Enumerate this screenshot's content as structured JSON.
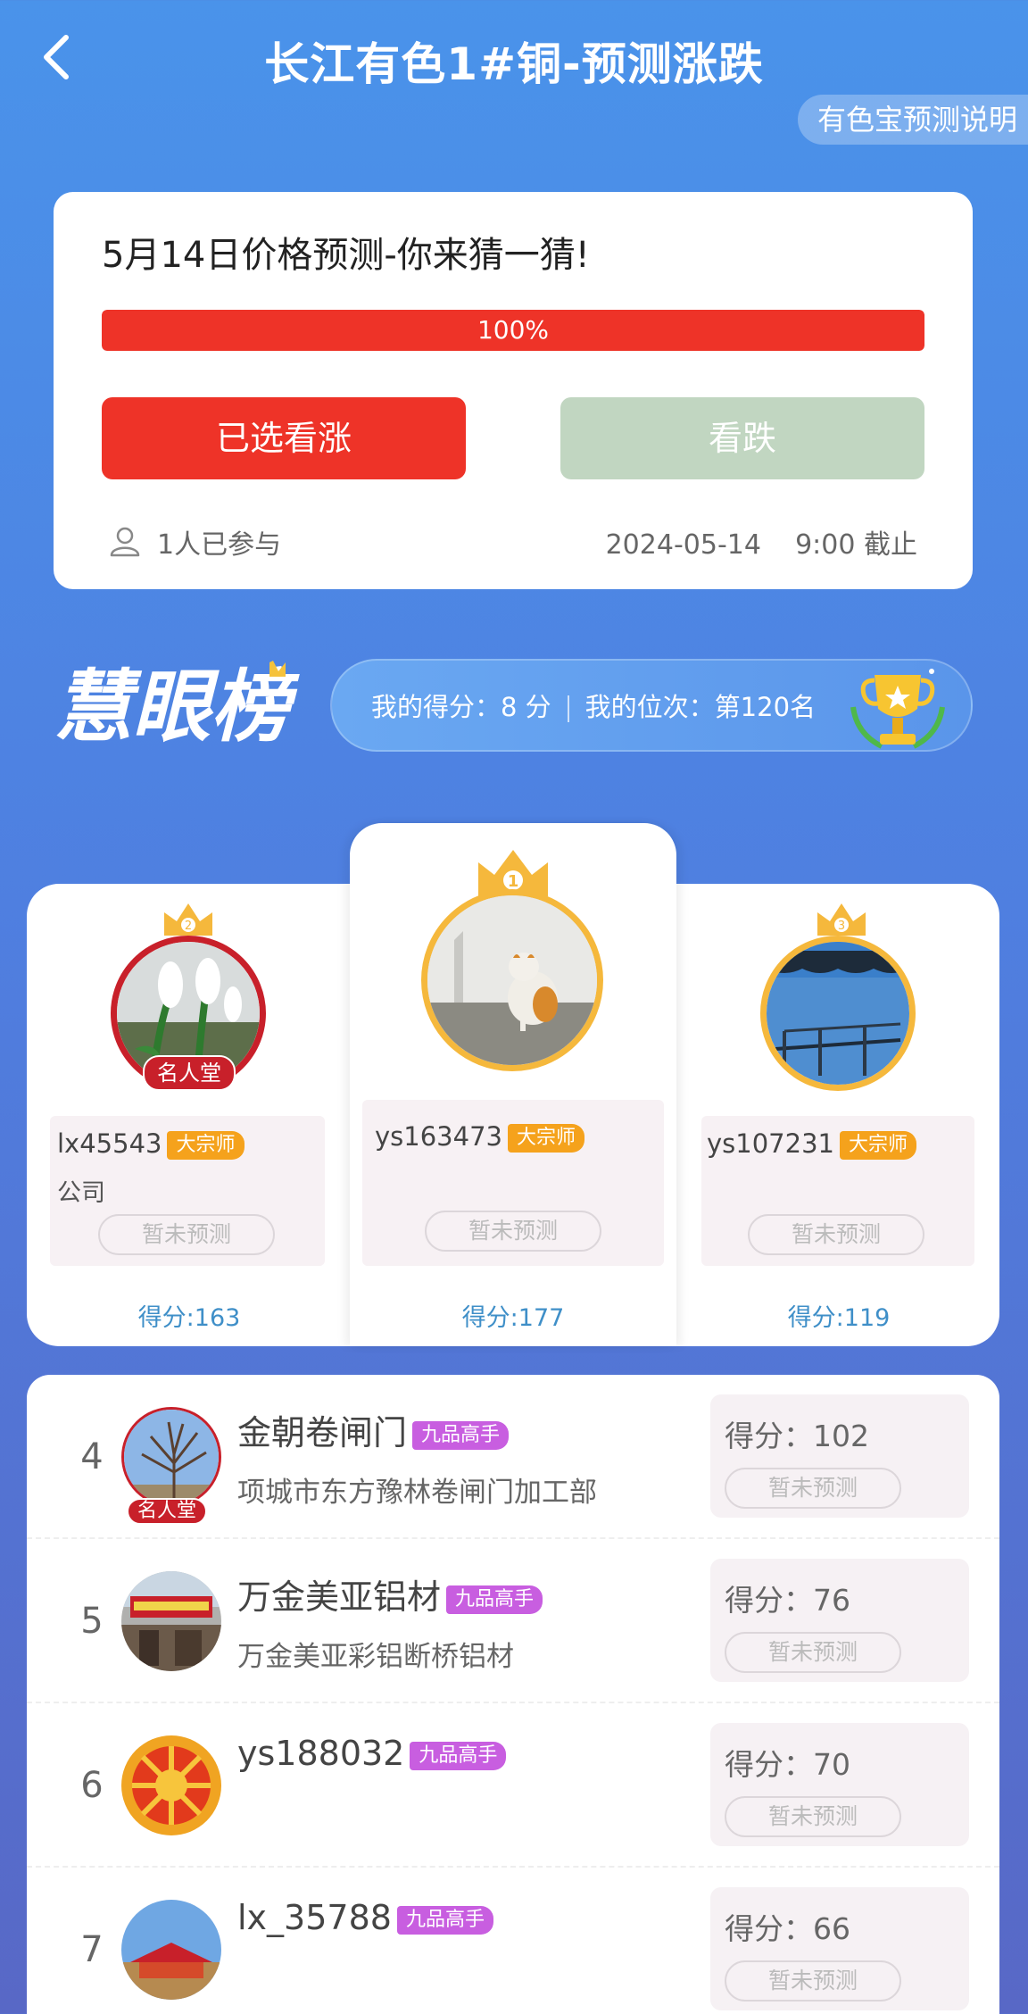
{
  "header": {
    "title": "长江有色1#铜-预测涨跌",
    "explain_label": "有色宝预测说明"
  },
  "predict": {
    "title": "5月14日价格预测-你来猜一猜!",
    "progress_label": "100%",
    "progress_value": 100,
    "up_button": "已选看涨",
    "down_button": "看跌",
    "participants": "1人已参与",
    "deadline": "2024-05-14    9:00 截止",
    "colors": {
      "up": "#ee3328",
      "down": "#c1d6c1"
    }
  },
  "ranking": {
    "my_score": "我的得分：8 分",
    "my_rank": "我的位次：第120名"
  },
  "podium": [
    {
      "rank": "2",
      "name": "lx45543",
      "badge": "大宗师",
      "sub": "公司",
      "fame": "名人堂",
      "status": "暂未预测",
      "score": "得分:163"
    },
    {
      "rank": "1",
      "name": "ys163473",
      "badge": "大宗师",
      "sub": "",
      "fame": "",
      "status": "暂未预测",
      "score": "得分:177"
    },
    {
      "rank": "3",
      "name": "ys107231",
      "badge": "大宗师",
      "sub": "",
      "fame": "",
      "status": "暂未预测",
      "score": "得分:119"
    }
  ],
  "list": [
    {
      "rank": "4",
      "name": "金朝卷闸门",
      "badge": "九品高手",
      "sub": "项城市东方豫林卷闸门加工部",
      "fame": "名人堂",
      "score": "得分：102",
      "status": "暂未预测"
    },
    {
      "rank": "5",
      "name": "万金美亚铝材",
      "badge": "九品高手",
      "sub": "万金美亚彩铝断桥铝材",
      "fame": "",
      "score": "得分：76",
      "status": "暂未预测"
    },
    {
      "rank": "6",
      "name": "ys188032",
      "badge": "九品高手",
      "sub": "",
      "fame": "",
      "score": "得分：70",
      "status": "暂未预测"
    },
    {
      "rank": "7",
      "name": "lx_35788",
      "badge": "九品高手",
      "sub": "",
      "fame": "",
      "score": "得分：66",
      "status": "暂未预测"
    }
  ]
}
